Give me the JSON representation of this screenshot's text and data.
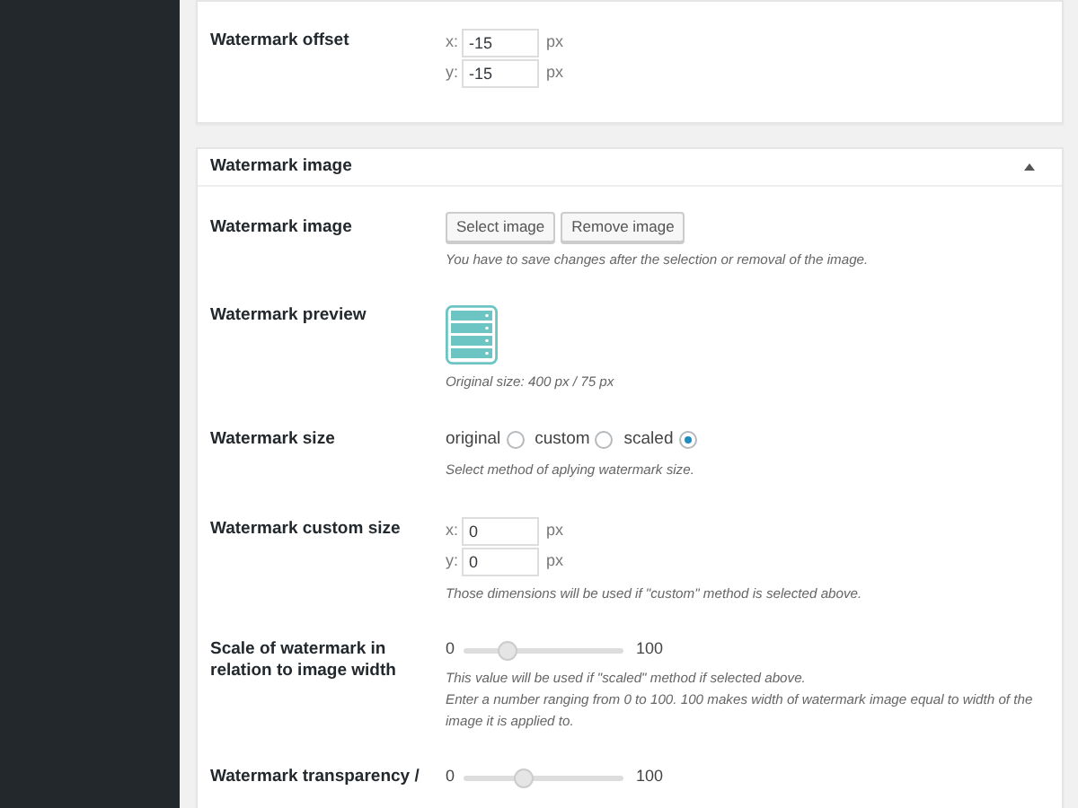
{
  "sections": [
    {
      "rows": [
        {
          "kind": "xy",
          "label": "Watermark offset",
          "fields": [
            {
              "axis": "x:",
              "value": "-15",
              "unit": "px"
            },
            {
              "axis": "y:",
              "value": "-15",
              "unit": "px"
            }
          ]
        }
      ]
    },
    {
      "title": "Watermark image",
      "expanded": true,
      "rows": [
        {
          "kind": "buttons",
          "label": "Watermark image",
          "buttons": [
            "Select image",
            "Remove image"
          ],
          "hints": [
            "You have to save changes after the selection or removal of the image."
          ]
        },
        {
          "kind": "preview",
          "label": "Watermark preview",
          "hints": [
            "Original size: 400 px / 75 px"
          ]
        },
        {
          "kind": "radios",
          "label": "Watermark size",
          "options": [
            {
              "label": "original",
              "selected": false
            },
            {
              "label": "custom",
              "selected": false
            },
            {
              "label": "scaled",
              "selected": true
            }
          ],
          "hints": [
            "Select method of aplying watermark size."
          ]
        },
        {
          "kind": "xy",
          "label": "Watermark custom size",
          "fields": [
            {
              "axis": "x:",
              "value": "0",
              "unit": "px"
            },
            {
              "axis": "y:",
              "value": "0",
              "unit": "px"
            }
          ],
          "hints": [
            "Those dimensions will be used if \"custom\" method is selected above."
          ]
        },
        {
          "kind": "slider",
          "label": "Scale of watermark in relation to image width",
          "min": "0",
          "max": "100",
          "level": 0.27,
          "hints": [
            "This value will be used if \"scaled\" method if selected above.",
            "Enter a number ranging from 0 to 100. 100 makes width of watermark image equal to width of the image it is applied to."
          ]
        },
        {
          "kind": "slider",
          "label": "Watermark transparency /",
          "min": "0",
          "max": "100",
          "level": 0.37
        }
      ]
    }
  ]
}
